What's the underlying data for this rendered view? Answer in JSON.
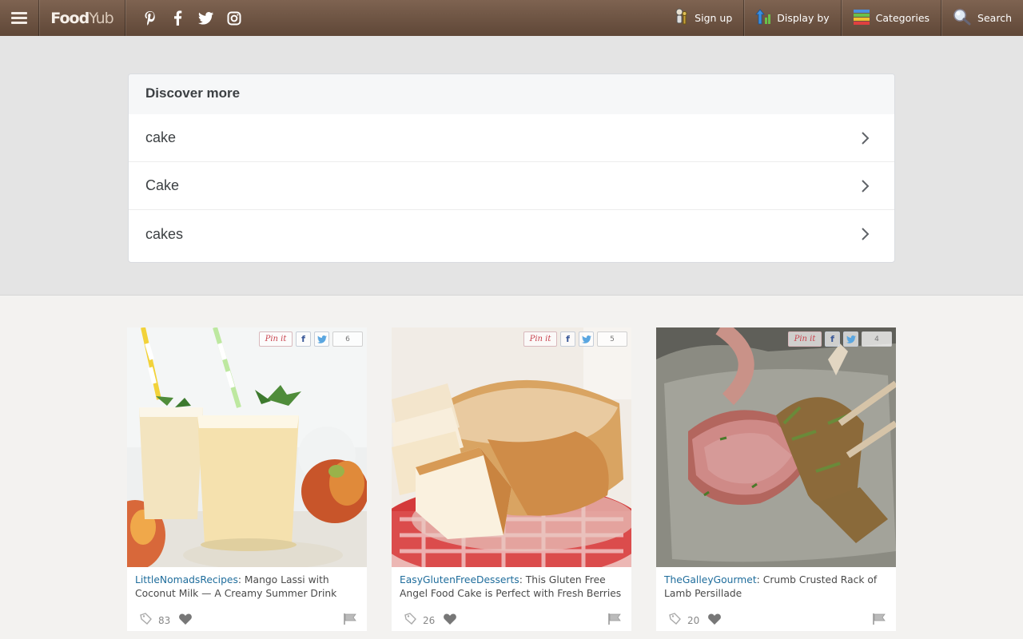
{
  "brand": {
    "name_bold": "Food",
    "name_light": "Yub"
  },
  "nav": {
    "signup": "Sign up",
    "display_by": "Display by",
    "categories": "Categories",
    "search": "Search"
  },
  "social_icons": [
    "pinterest-icon",
    "facebook-icon",
    "twitter-icon",
    "instagram-icon"
  ],
  "discover": {
    "title": "Discover more",
    "items": [
      {
        "label": "cake"
      },
      {
        "label": "Cake"
      },
      {
        "label": "cakes"
      }
    ]
  },
  "cards": [
    {
      "author": "LittleNomadsRecipes",
      "title": "Mango Lassi with Coconut Milk — A Creamy Summer Drink",
      "share_count": "6",
      "saves": "83",
      "pin_label": "Pin it",
      "fb": "f"
    },
    {
      "author": "EasyGlutenFreeDesserts",
      "title": "This Gluten Free Angel Food Cake is Perfect with Fresh Berries",
      "share_count": "5",
      "saves": "26",
      "pin_label": "Pin it",
      "fb": "f"
    },
    {
      "author": "TheGalleyGourmet",
      "title": "Crumb Crusted Rack of Lamb Persillade",
      "share_count": "4",
      "saves": "20",
      "pin_label": "Pin it",
      "fb": "f"
    }
  ],
  "colors": {
    "topbar": "#6e5544",
    "author_link": "#1f6d9c",
    "band": "#e4e4e4",
    "page": "#f3f2f0"
  }
}
